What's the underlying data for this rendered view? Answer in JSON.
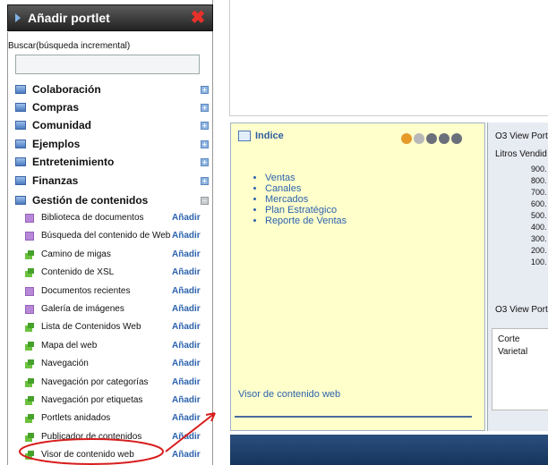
{
  "panel": {
    "title": "Añadir portlet",
    "search_label": "Buscar(búsqueda incremental)",
    "search_value": "",
    "categories": [
      {
        "label": "Colaboración"
      },
      {
        "label": "Compras"
      },
      {
        "label": "Comunidad"
      },
      {
        "label": "Ejemplos"
      },
      {
        "label": "Entretenimiento"
      },
      {
        "label": "Finanzas"
      },
      {
        "label": "Gestión de contenidos"
      }
    ],
    "items": [
      {
        "label": "Biblioteca de documentos",
        "add": "Añadir",
        "icon": "purple"
      },
      {
        "label": "Búsqueda del contenido de Web",
        "add": "Añadir",
        "icon": "purple"
      },
      {
        "label": "Camino de migas",
        "add": "Añadir",
        "icon": "green"
      },
      {
        "label": "Contenido de XSL",
        "add": "Añadir",
        "icon": "green"
      },
      {
        "label": "Documentos recientes",
        "add": "Añadir",
        "icon": "purple"
      },
      {
        "label": "Galería de imágenes",
        "add": "Añadir",
        "icon": "purple"
      },
      {
        "label": "Lista de Contenidos Web",
        "add": "Añadir",
        "icon": "green"
      },
      {
        "label": "Mapa del web",
        "add": "Añadir",
        "icon": "green"
      },
      {
        "label": "Navegación",
        "add": "Añadir",
        "icon": "green"
      },
      {
        "label": "Navegación por categorías",
        "add": "Añadir",
        "icon": "green"
      },
      {
        "label": "Navegación por etiquetas",
        "add": "Añadir",
        "icon": "green"
      },
      {
        "label": "Portlets anidados",
        "add": "Añadir",
        "icon": "green"
      },
      {
        "label": "Publicador de contenidos",
        "add": "Añadir",
        "icon": "green"
      },
      {
        "label": "Visor de contenido web",
        "add": "Añadir",
        "icon": "green"
      }
    ]
  },
  "indice": {
    "title": "Indice",
    "links": [
      "Ventas",
      "Canales",
      "Mercados",
      "Plan Estratégico",
      "Reporte de Ventas"
    ],
    "footer": "Visor de contenido web"
  },
  "o3": {
    "title1": "O3 View Port",
    "subtitle": "Litros Vendid",
    "ticks": [
      "900.",
      "800.",
      "700.",
      "600.",
      "500.",
      "400.",
      "300.",
      "200.",
      "100."
    ],
    "title2": "O3 View Port",
    "rows": [
      "Corte",
      "Varietal"
    ]
  },
  "colors": {
    "accent": "#2d63ad",
    "highlight": "#d81d1d"
  }
}
